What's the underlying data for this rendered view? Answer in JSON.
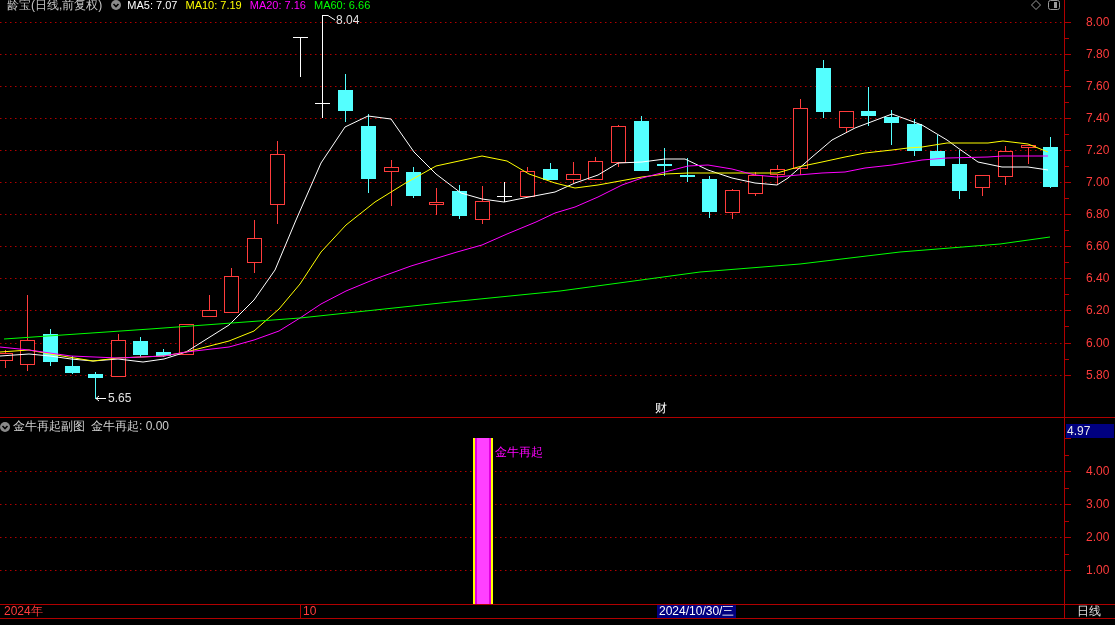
{
  "header": {
    "title": "龄宝(日线,前复权)",
    "indicators": [
      {
        "label": "MA5: 7.07",
        "color": "#ffffff"
      },
      {
        "label": "MA10: 7.19",
        "color": "#ffff00"
      },
      {
        "label": "MA20: 7.16",
        "color": "#ff00ff"
      },
      {
        "label": "MA60: 6.66",
        "color": "#00ff00"
      }
    ]
  },
  "price_axis": {
    "labels": [
      "8.00",
      "7.80",
      "7.60",
      "7.40",
      "7.20",
      "7.00",
      "6.80",
      "6.60",
      "6.40",
      "6.20",
      "6.00",
      "5.80"
    ]
  },
  "annotations": {
    "high": "8.04",
    "low": "5.65",
    "marker": "财"
  },
  "sub_chart": {
    "title": "金牛再起副图",
    "reading": "金牛再起: 0.00",
    "signal_label": "金牛再起",
    "current_value": "4.97",
    "axis_labels": [
      "4.00",
      "3.00",
      "2.00",
      "1.00"
    ]
  },
  "time_axis": {
    "labels": [
      "2024年",
      "10"
    ],
    "cursor_date": "2024/10/30/三",
    "period": "日线"
  }
}
